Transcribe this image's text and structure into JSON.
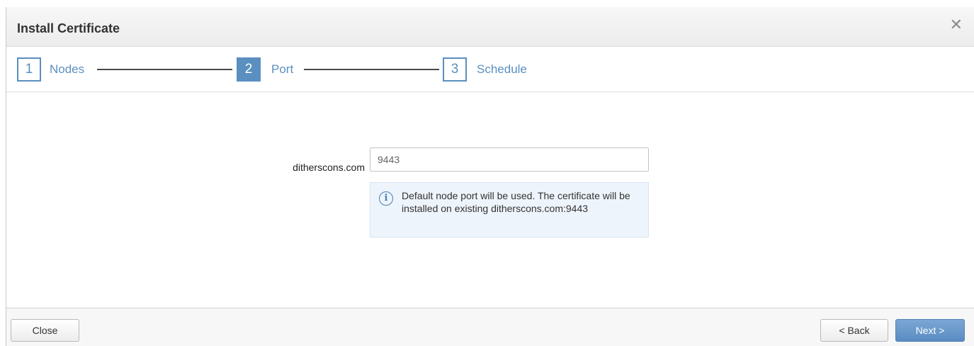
{
  "dialog": {
    "title": "Install Certificate",
    "close_symbol": "✕"
  },
  "wizard": {
    "steps": [
      {
        "number": "1",
        "label": "Nodes",
        "active": false
      },
      {
        "number": "2",
        "label": "Port",
        "active": true
      },
      {
        "number": "3",
        "label": "Schedule",
        "active": false
      }
    ]
  },
  "form": {
    "field_label": "ditherscons.com",
    "port_value": "9443",
    "info_icon": "info-icon",
    "info_text": "Default node port will be used. The certificate will be installed on existing ditherscons.com:9443"
  },
  "footer": {
    "close_label": "Close",
    "back_label": "< Back",
    "next_label": "Next >"
  },
  "colors": {
    "accent": "#5a8fc0",
    "info_bg": "#eef4fb"
  }
}
